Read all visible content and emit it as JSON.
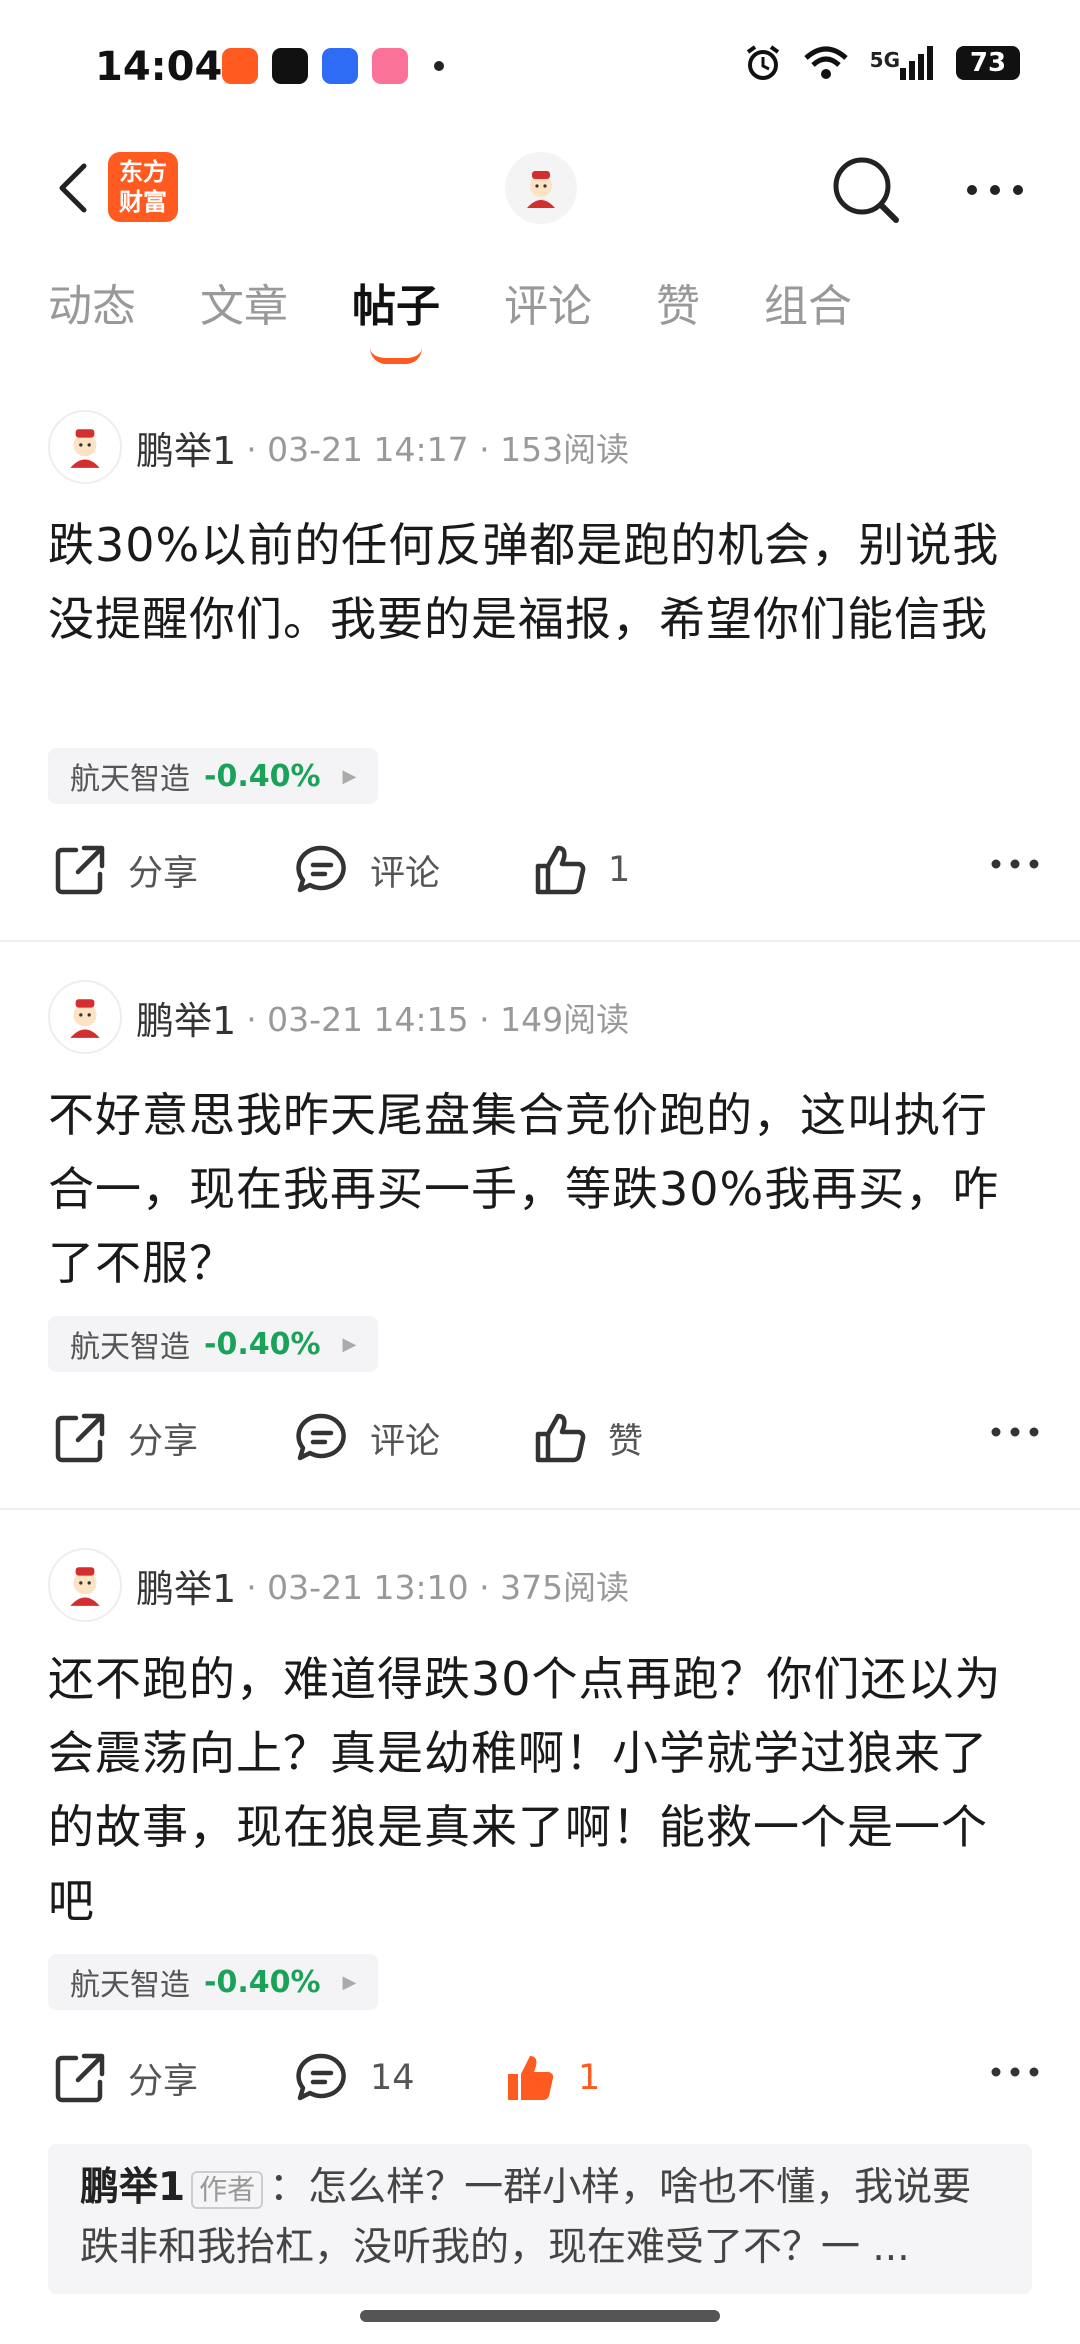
{
  "status_bar": {
    "time": "14:04",
    "battery": "73",
    "network": "5G"
  },
  "header": {
    "logo_line1": "东方",
    "logo_line2": "财富"
  },
  "tabs": [
    {
      "label": "动态",
      "active": false
    },
    {
      "label": "文章",
      "active": false
    },
    {
      "label": "帖子",
      "active": true
    },
    {
      "label": "评论",
      "active": false
    },
    {
      "label": "赞",
      "active": false
    },
    {
      "label": "组合",
      "active": false
    }
  ],
  "posts": [
    {
      "author": "鹏举1",
      "meta": "· 03-21 14:17 · 153阅读",
      "content": "跌30%以前的任何反弹都是跑的机会，别说我没提醒你们。我要的是福报，希望你们能信我",
      "stock_name": "航天智造",
      "stock_change": "-0.40%",
      "share_label": "分享",
      "comment_label": "评论",
      "like_label": "1",
      "liked": false
    },
    {
      "author": "鹏举1",
      "meta": "· 03-21 14:15 · 149阅读",
      "content": "不好意思我昨天尾盘集合竞价跑的，这叫执行合一，现在我再买一手，等跌30%我再买，咋了不服？",
      "stock_name": "航天智造",
      "stock_change": "-0.40%",
      "share_label": "分享",
      "comment_label": "评论",
      "like_label": "赞",
      "liked": false
    },
    {
      "author": "鹏举1",
      "meta": "· 03-21 13:10 · 375阅读",
      "content": "还不跑的，难道得跌30个点再跑？你们还以为会震荡向上？真是幼稚啊！小学就学过狼来了的故事，现在狼是真来了啊！能救一个是一个吧",
      "stock_name": "航天智造",
      "stock_change": "-0.40%",
      "share_label": "分享",
      "comment_label": "14",
      "like_label": "1",
      "liked": true
    }
  ],
  "reply": {
    "author": "鹏举1",
    "badge": "作者",
    "text": "：怎么样？一群小样，啥也不懂，我说要跌非和我抬杠，没听我的，现在难受了不？一 ..."
  },
  "colors": {
    "accent": "#ff5a1f",
    "stock_down": "#1aa259"
  }
}
